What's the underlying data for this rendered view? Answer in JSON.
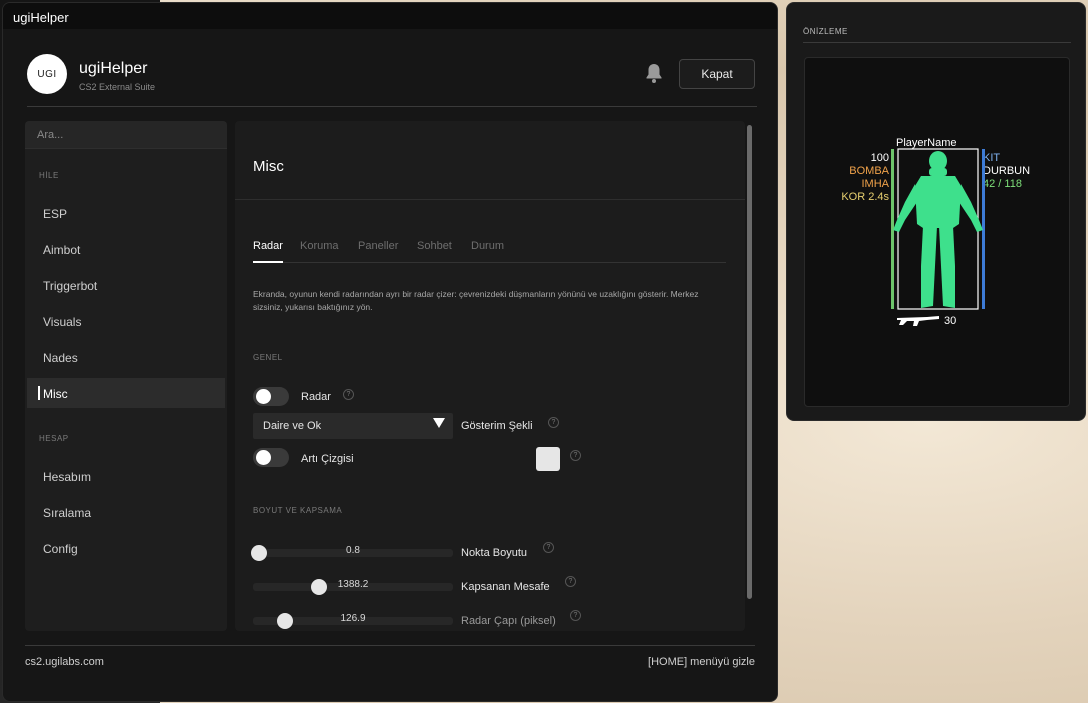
{
  "window": {
    "title": "ugiHelper",
    "logo": "UGI",
    "app_name": "ugiHelper",
    "app_subtitle": "CS2 External Suite",
    "close_label": "Kapat"
  },
  "sidebar": {
    "search_placeholder": "Ara...",
    "sections": [
      {
        "label": "HİLE",
        "items": [
          "ESP",
          "Aimbot",
          "Triggerbot",
          "Visuals",
          "Nades",
          "Misc"
        ]
      },
      {
        "label": "HESAP",
        "items": [
          "Hesabım",
          "Sıralama",
          "Config"
        ]
      }
    ],
    "active_item": "Misc"
  },
  "content": {
    "title": "Misc",
    "tabs": [
      "Radar",
      "Koruma",
      "Paneller",
      "Sohbet",
      "Durum"
    ],
    "active_tab": "Radar",
    "description": "Ekranda, oyunun kendi radarından ayrı bir radar çizer: çevrenizdeki düşmanların yönünü ve uzaklığını gösterir. Merkez sizsiniz, yukarısı baktığınız yön.",
    "group_general": "GENEL",
    "radar_label": "Radar",
    "display_mode_value": "Daire ve Ok",
    "display_mode_label": "Gösterim Şekli",
    "crosshair_label": "Artı Çizgisi",
    "group_size": "BOYUT VE KAPSAMA",
    "sliders": [
      {
        "label": "Nokta Boyutu",
        "value": "0.8",
        "fraction": 0.03
      },
      {
        "label": "Kapsanan Mesafe",
        "value": "1388.2",
        "fraction": 0.33
      },
      {
        "label": "Radar Çapı (piksel)",
        "value": "126.9",
        "fraction": 0.16
      }
    ],
    "help_glyph": "?"
  },
  "footer": {
    "left": "cs2.ugilabs.com",
    "right": "[HOME] menüyü gizle"
  },
  "preview": {
    "title": "ÖNİZLEME",
    "player_name": "PlayerName",
    "left_lines": [
      "100",
      "BOMBA",
      "IMHA",
      "KOR 2.4s"
    ],
    "right_lines": [
      "KIT",
      "DURBUN",
      "42 / 118"
    ],
    "ammo": "30"
  },
  "colors": {
    "health_bar": "#6ec46b",
    "armor_bar": "#3d7bd6",
    "model": "#3ee08c",
    "orange": "#f0a24a",
    "yellow": "#e8d070",
    "ammo_green": "#7ee07a"
  }
}
